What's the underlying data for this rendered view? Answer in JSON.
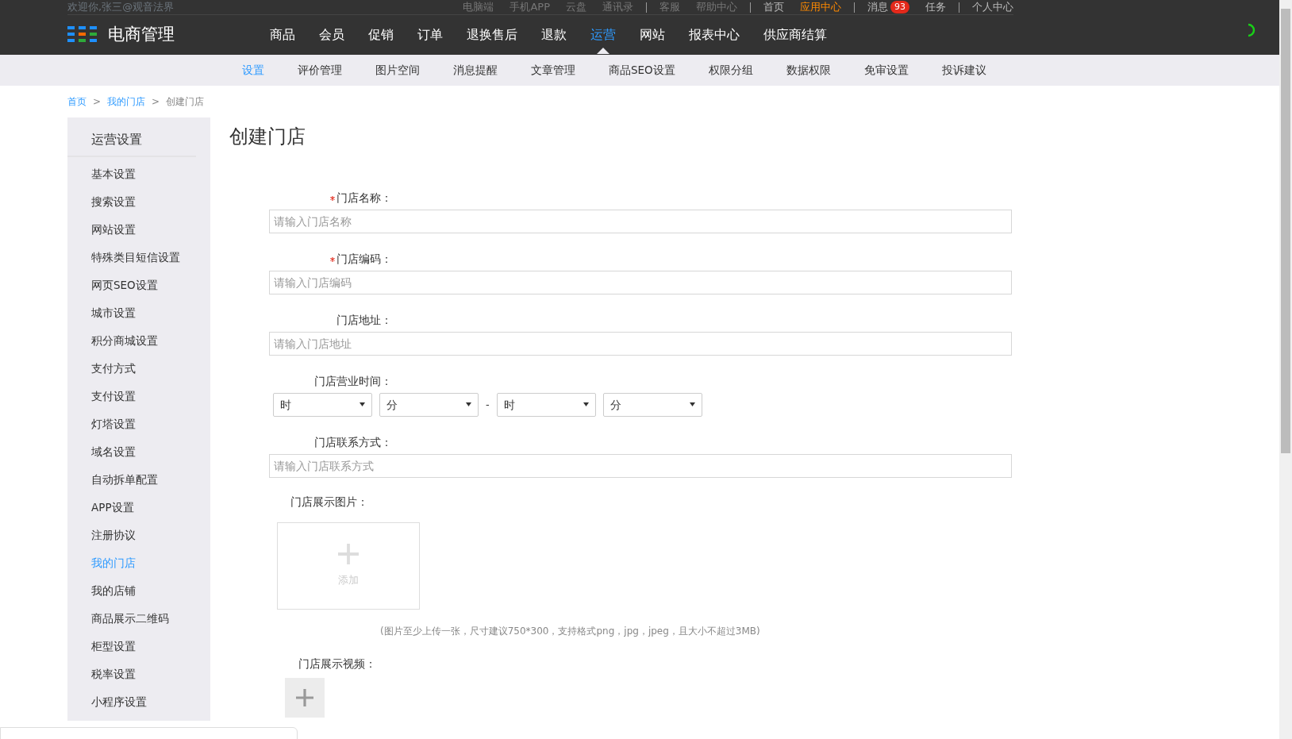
{
  "top_bar": {
    "welcome": "欢迎你,张三@观音法界",
    "groups": [
      {
        "kind": "muted",
        "links": [
          {
            "label": "电脑端",
            "highlighted": false
          },
          {
            "label": "手机APP",
            "highlighted": false
          },
          {
            "label": "云盘",
            "highlighted": false
          },
          {
            "label": "通讯录",
            "highlighted": false
          }
        ]
      },
      {
        "kind": "muted",
        "links": [
          {
            "label": "客服",
            "highlighted": false
          },
          {
            "label": "帮助中心",
            "highlighted": false
          }
        ]
      },
      {
        "kind": "normal",
        "links": [
          {
            "label": "首页",
            "highlighted": false
          },
          {
            "label": "应用中心",
            "highlighted": true
          }
        ]
      },
      {
        "kind": "normal",
        "links": [
          {
            "label": "消息",
            "highlighted": false,
            "badge": "93"
          },
          {
            "label": "任务",
            "highlighted": false
          }
        ]
      },
      {
        "kind": "normal",
        "links": [
          {
            "label": "个人中心",
            "highlighted": false
          }
        ]
      }
    ]
  },
  "brand": {
    "title": "电商管理"
  },
  "main_nav": [
    {
      "label": "商品",
      "selected": false
    },
    {
      "label": "会员",
      "selected": false
    },
    {
      "label": "促销",
      "selected": false
    },
    {
      "label": "订单",
      "selected": false
    },
    {
      "label": "退换售后",
      "selected": false
    },
    {
      "label": "退款",
      "selected": false
    },
    {
      "label": "运营",
      "selected": true
    },
    {
      "label": "网站",
      "selected": false
    },
    {
      "label": "报表中心",
      "selected": false
    },
    {
      "label": "供应商结算",
      "selected": false
    }
  ],
  "sub_nav": [
    {
      "label": "设置",
      "selected": true
    },
    {
      "label": "评价管理",
      "selected": false
    },
    {
      "label": "图片空间",
      "selected": false
    },
    {
      "label": "消息提醒",
      "selected": false
    },
    {
      "label": "文章管理",
      "selected": false
    },
    {
      "label": "商品SEO设置",
      "selected": false
    },
    {
      "label": "权限分组",
      "selected": false
    },
    {
      "label": "数据权限",
      "selected": false
    },
    {
      "label": "免审设置",
      "selected": false
    },
    {
      "label": "投诉建议",
      "selected": false
    }
  ],
  "breadcrumb": [
    {
      "label": "首页",
      "link": true
    },
    {
      "separator": ">",
      "label": "我的门店",
      "link": true
    },
    {
      "separator": ">",
      "label": "创建门店",
      "link": false
    }
  ],
  "sidebar": {
    "title": "运营设置",
    "items": [
      {
        "label": "基本设置",
        "selected": false
      },
      {
        "label": "搜索设置",
        "selected": false
      },
      {
        "label": "网站设置",
        "selected": false
      },
      {
        "label": "特殊类目短信设置",
        "selected": false
      },
      {
        "label": "网页SEO设置",
        "selected": false
      },
      {
        "label": "城市设置",
        "selected": false
      },
      {
        "label": "积分商城设置",
        "selected": false
      },
      {
        "label": "支付方式",
        "selected": false
      },
      {
        "label": "支付设置",
        "selected": false
      },
      {
        "label": "灯塔设置",
        "selected": false
      },
      {
        "label": "域名设置",
        "selected": false
      },
      {
        "label": "自动拆单配置",
        "selected": false
      },
      {
        "label": "APP设置",
        "selected": false
      },
      {
        "label": "注册协议",
        "selected": false
      },
      {
        "label": "我的门店",
        "selected": true
      },
      {
        "label": "我的店铺",
        "selected": false
      },
      {
        "label": "商品展示二维码",
        "selected": false
      },
      {
        "label": "柜型设置",
        "selected": false
      },
      {
        "label": "税率设置",
        "selected": false
      },
      {
        "label": "小程序设置",
        "selected": false
      }
    ]
  },
  "page_title": "创建门店",
  "form": [
    {
      "kind": "text",
      "label": "门店名称：",
      "required": true,
      "placeholder": "请输入门店名称"
    },
    {
      "kind": "text",
      "label": "门店编码：",
      "required": true,
      "placeholder": "请输入门店编码"
    },
    {
      "kind": "text",
      "label": "门店地址：",
      "required": false,
      "placeholder": "请输入门店地址"
    },
    {
      "kind": "time",
      "label": "门店营业时间：",
      "required": false,
      "selects": [
        "时",
        "分",
        "时",
        "分"
      ],
      "separator": "-"
    },
    {
      "kind": "text",
      "label": "门店联系方式：",
      "required": false,
      "placeholder": "请输入门店联系方式"
    },
    {
      "kind": "image",
      "label": "门店展示图片：",
      "required": false,
      "add_label": "添加",
      "hint": "(图片至少上传一张，尺寸建议750*300，支持格式png，jpg，jpeg，且大小不超过3MB)"
    },
    {
      "kind": "video",
      "label": "门店展示视频：",
      "required": false
    }
  ]
}
